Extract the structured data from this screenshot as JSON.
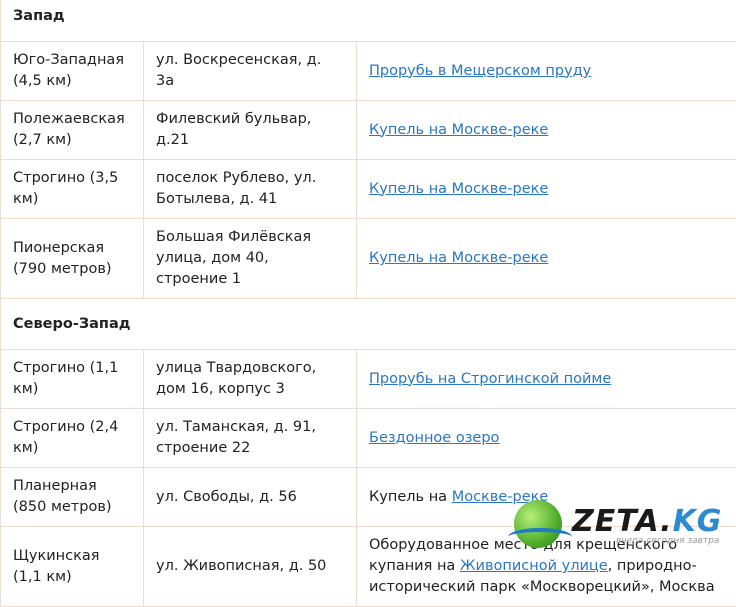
{
  "sections": [
    {
      "title": "Запад",
      "rows": [
        {
          "metro": "Юго-Западная (4,5 км)",
          "address": "ул. Воскресенская, д. 3а",
          "desc_prefix": "",
          "link": "Прорубь в Мещерском пруду"
        },
        {
          "metro": "Полежаевская (2,7 км)",
          "address": "Филевский бульвар, д.21",
          "desc_prefix": "",
          "link": "Купель на Москве-реке"
        },
        {
          "metro": "Строгино (3,5 км)",
          "address": "поселок Рублево, ул. Ботылева, д. 41",
          "desc_prefix": "",
          "link": "Купель на Москве-реке"
        },
        {
          "metro": "Пионерская (790 метров)",
          "address": "Большая Филёвская улица, дом 40, строение 1",
          "desc_prefix": "",
          "link": "Купель на Москве-реке"
        }
      ]
    },
    {
      "title": "Северо-Запад",
      "rows": [
        {
          "metro": "Строгино (1,1 км)",
          "address": "улица Твардовского, дом 16, корпус 3",
          "desc_prefix": "",
          "link": "Прорубь на Строгинской пойме"
        },
        {
          "metro": "Строгино (2,4 км)",
          "address": "ул. Таманская, д. 91, строение 22",
          "desc_prefix": "",
          "link": "Бездонное озеро"
        },
        {
          "metro": "Планерная (850 метров)",
          "address": "ул. Свободы, д. 56",
          "desc_prefix": "Купель на ",
          "link": "Москве-реке"
        }
      ]
    }
  ],
  "last_row": {
    "metro": "Щукинская (1,1 км)",
    "address": "ул. Живописная, д. 50",
    "desc_before": "Оборудованное место для крещенского купания на ",
    "link": "Живописной улице",
    "desc_after": ", природно-исторический парк «Москворецкий», Москва"
  },
  "watermark": {
    "brand": "ZETA.",
    "tld": "KG",
    "tagline": "вчера сегодня завтра"
  },
  "colors": {
    "link": "#2a77c4",
    "border": "#eedccc"
  }
}
